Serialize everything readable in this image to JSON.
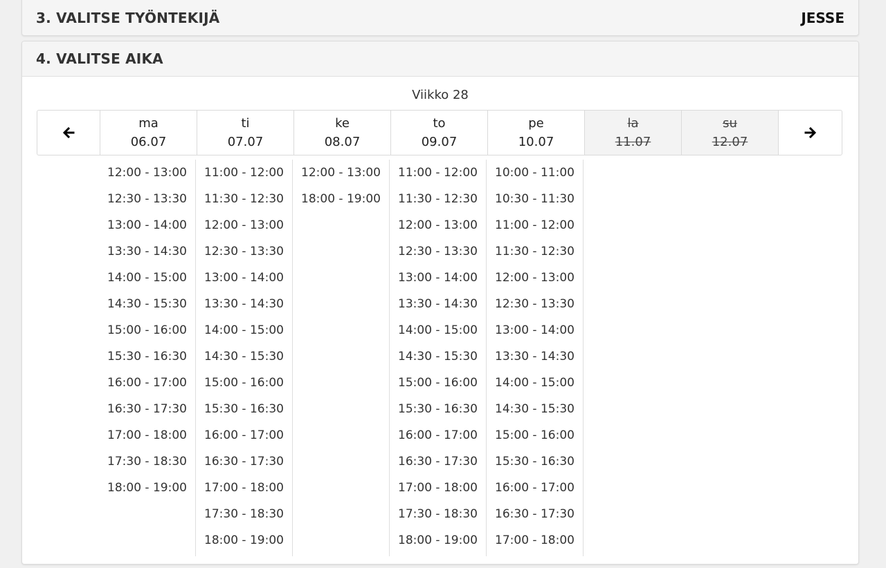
{
  "step3": {
    "title": "3. VALITSE TYÖNTEKIJÄ",
    "selected": "JESSE"
  },
  "step4": {
    "title": "4. VALITSE AIKA"
  },
  "calendar": {
    "week_label": "Viikko 28",
    "prev_icon": "arrow-left-icon",
    "next_icon": "arrow-right-icon",
    "days": [
      {
        "abbr": "ma",
        "date": "06.07",
        "available": true,
        "slots": [
          "12:00 - 13:00",
          "12:30 - 13:30",
          "13:00 - 14:00",
          "13:30 - 14:30",
          "14:00 - 15:00",
          "14:30 - 15:30",
          "15:00 - 16:00",
          "15:30 - 16:30",
          "16:00 - 17:00",
          "16:30 - 17:30",
          "17:00 - 18:00",
          "17:30 - 18:30",
          "18:00 - 19:00"
        ]
      },
      {
        "abbr": "ti",
        "date": "07.07",
        "available": true,
        "slots": [
          "11:00 - 12:00",
          "11:30 - 12:30",
          "12:00 - 13:00",
          "12:30 - 13:30",
          "13:00 - 14:00",
          "13:30 - 14:30",
          "14:00 - 15:00",
          "14:30 - 15:30",
          "15:00 - 16:00",
          "15:30 - 16:30",
          "16:00 - 17:00",
          "16:30 - 17:30",
          "17:00 - 18:00",
          "17:30 - 18:30",
          "18:00 - 19:00"
        ]
      },
      {
        "abbr": "ke",
        "date": "08.07",
        "available": true,
        "slots": [
          "12:00 - 13:00",
          "18:00 - 19:00"
        ]
      },
      {
        "abbr": "to",
        "date": "09.07",
        "available": true,
        "slots": [
          "11:00 - 12:00",
          "11:30 - 12:30",
          "12:00 - 13:00",
          "12:30 - 13:30",
          "13:00 - 14:00",
          "13:30 - 14:30",
          "14:00 - 15:00",
          "14:30 - 15:30",
          "15:00 - 16:00",
          "15:30 - 16:30",
          "16:00 - 17:00",
          "16:30 - 17:30",
          "17:00 - 18:00",
          "17:30 - 18:30",
          "18:00 - 19:00"
        ]
      },
      {
        "abbr": "pe",
        "date": "10.07",
        "available": true,
        "slots": [
          "10:00 - 11:00",
          "10:30 - 11:30",
          "11:00 - 12:00",
          "11:30 - 12:30",
          "12:00 - 13:00",
          "12:30 - 13:30",
          "13:00 - 14:00",
          "13:30 - 14:30",
          "14:00 - 15:00",
          "14:30 - 15:30",
          "15:00 - 16:00",
          "15:30 - 16:30",
          "16:00 - 17:00",
          "16:30 - 17:30",
          "17:00 - 18:00"
        ]
      },
      {
        "abbr": "la",
        "date": "11.07",
        "available": false,
        "slots": []
      },
      {
        "abbr": "su",
        "date": "12.07",
        "available": false,
        "slots": []
      }
    ]
  }
}
